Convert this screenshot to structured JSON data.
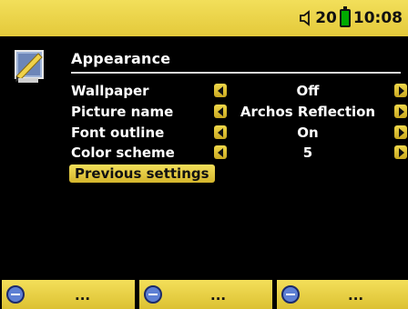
{
  "status": {
    "volume": "20",
    "time": "10:08"
  },
  "section": {
    "title": "Appearance"
  },
  "settings": [
    {
      "label": "Wallpaper",
      "value": "Off"
    },
    {
      "label": "Picture name",
      "value": "Archos Reflection"
    },
    {
      "label": "Font outline",
      "value": "On"
    },
    {
      "label": "Color scheme",
      "value": "5"
    }
  ],
  "previous_settings_label": "Previous settings",
  "softkeys": [
    {
      "label": "..."
    },
    {
      "label": "..."
    },
    {
      "label": "..."
    }
  ],
  "colors": {
    "accent": "#e8cf45",
    "background": "#000000",
    "text": "#ffffff"
  }
}
